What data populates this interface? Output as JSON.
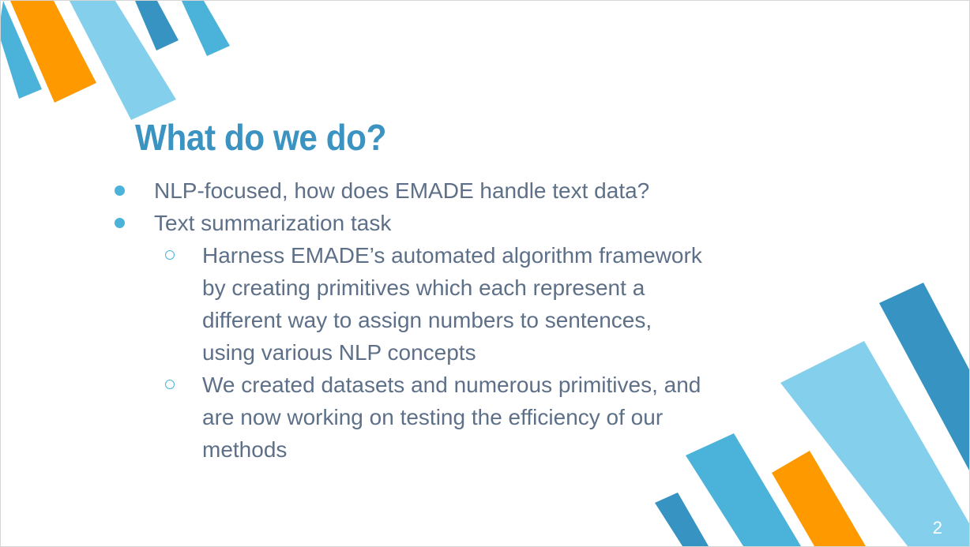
{
  "slide": {
    "title": "What do we do?",
    "bullets": [
      {
        "text": "NLP-focused, how does EMADE handle text data?"
      },
      {
        "text": "Text summarization task",
        "sub": [
          "Harness EMADE’s automated algorithm framework by creating primitives which each represent a different way to assign numbers to sentences, using various NLP concepts",
          "We created datasets and numerous primitives, and are now working on testing the efficiency of our methods"
        ]
      }
    ],
    "page_number": "2"
  },
  "colors": {
    "title": "#3a93c0",
    "body_text": "#5d7088",
    "bullet": "#4bb3d9",
    "stripe_blue": "#4bb3d9",
    "stripe_dark_blue": "#3693c2",
    "stripe_light_blue": "#84d0ec",
    "stripe_orange": "#fe9a00"
  }
}
